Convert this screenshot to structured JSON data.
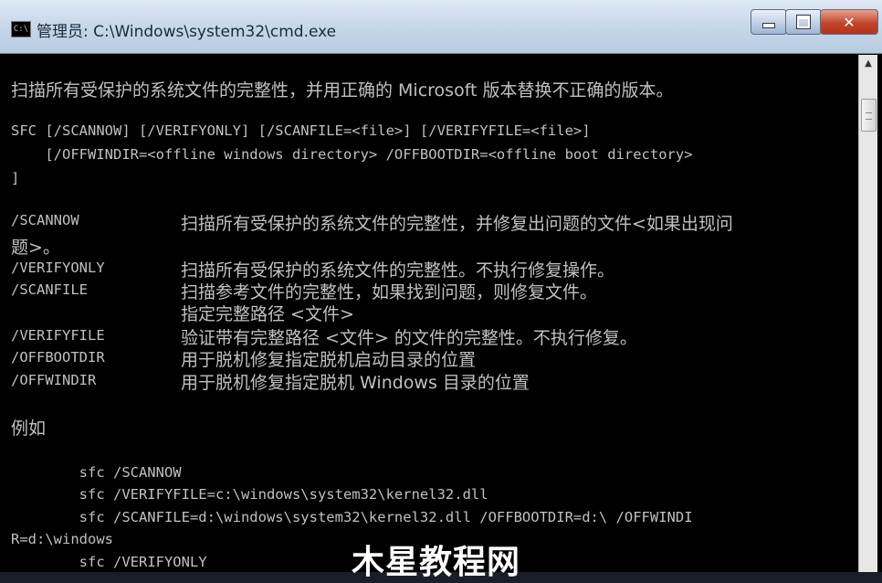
{
  "window": {
    "title": "管理员: C:\\Windows\\system32\\cmd.exe",
    "icon": "cmd-app-icon"
  },
  "controls": {
    "minimize": "minimize",
    "maximize": "maximize",
    "close": "✕"
  },
  "console": {
    "intro": "扫描所有受保护的系统文件的完整性，并用正确的 Microsoft 版本替换不正确的版本。",
    "syntax1": "SFC [/SCANNOW] [/VERIFYONLY] [/SCANFILE=<file>] [/VERIFYFILE=<file>]",
    "syntax2": "    [/OFFWINDIR=<offline windows directory> /OFFBOOTDIR=<offline boot directory>",
    "syntax3": "]",
    "options": [
      {
        "name": "/SCANNOW",
        "desc": "扫描所有受保护的系统文件的完整性，并修复出问题的文件<如果出现问"
      },
      {
        "name": "",
        "desc": "题>。"
      },
      {
        "name": "/VERIFYONLY",
        "desc": "扫描所有受保护的系统文件的完整性。不执行修复操作。"
      },
      {
        "name": "/SCANFILE",
        "desc": "扫描参考文件的完整性，如果找到问题，则修复文件。"
      },
      {
        "name": "",
        "desc": "指定完整路径 <文件>"
      },
      {
        "name": "/VERIFYFILE",
        "desc": "验证带有完整路径 <文件> 的文件的完整性。不执行修复。"
      },
      {
        "name": "/OFFBOOTDIR",
        "desc": "用于脱机修复指定脱机启动目录的位置"
      },
      {
        "name": "/OFFWINDIR",
        "desc": "用于脱机修复指定脱机 Windows 目录的位置"
      }
    ],
    "examples_heading": "例如",
    "examples": [
      "        sfc /SCANNOW",
      "        sfc /VERIFYFILE=c:\\windows\\system32\\kernel32.dll",
      "        sfc /SCANFILE=d:\\windows\\system32\\kernel32.dll /OFFBOOTDIR=d:\\ /OFFWINDI",
      "R=d:\\windows",
      "        sfc /VERIFYONLY"
    ]
  },
  "watermark": "木星教程网"
}
